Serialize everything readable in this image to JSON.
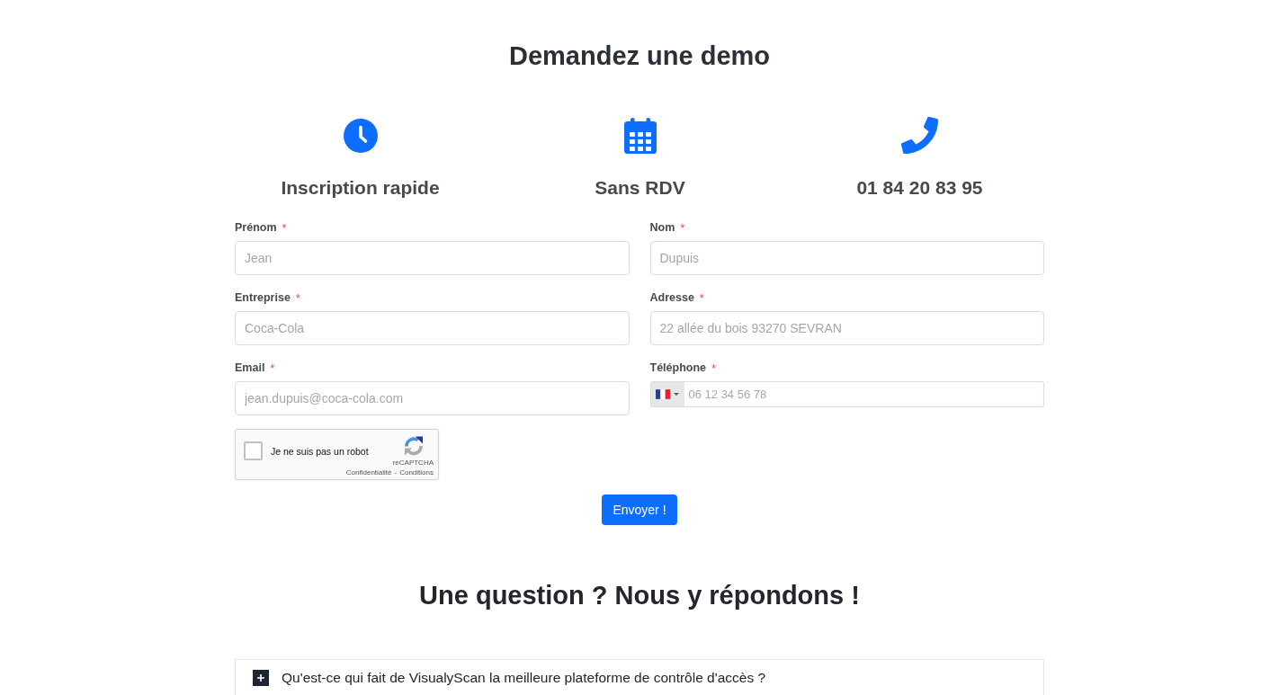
{
  "header": {
    "title": "Demandez une demo"
  },
  "features": [
    {
      "kind": "clock",
      "label": "Inscription rapide"
    },
    {
      "kind": "calendar",
      "label": "Sans RDV"
    },
    {
      "kind": "phone",
      "label": "01 84 20 83 95"
    }
  ],
  "form": {
    "fields": [
      {
        "kind": "text",
        "label": "Prénom",
        "required_mark": "*",
        "placeholder": "Jean"
      },
      {
        "kind": "text",
        "label": "Nom",
        "required_mark": "*",
        "placeholder": "Dupuis"
      },
      {
        "kind": "text",
        "label": "Entreprise",
        "required_mark": "*",
        "placeholder": "Coca-Cola"
      },
      {
        "kind": "text",
        "label": "Adresse",
        "required_mark": "*",
        "placeholder": "22 allée du bois 93270 SEVRAN"
      },
      {
        "kind": "text",
        "label": "Email",
        "required_mark": "*",
        "placeholder": "jean.dupuis@coca-cola.com"
      },
      {
        "kind": "phone",
        "label": "Téléphone",
        "required_mark": "*",
        "placeholder": "06 12 34 56 78"
      }
    ],
    "captcha": {
      "checked": false,
      "label": "Je ne suis pas un robot",
      "brand": "reCAPTCHA",
      "privacy_link": "Confidentialité",
      "separator": "-",
      "terms_link": "Conditions"
    },
    "submit_button": "Envoyer !"
  },
  "faq": {
    "title": "Une question ? Nous y répondons !",
    "items": [
      {
        "question": "Qu'est-ce qui fait de VisualyScan la meilleure plateforme de contrôle d'accès ?",
        "expanded": false
      }
    ]
  }
}
